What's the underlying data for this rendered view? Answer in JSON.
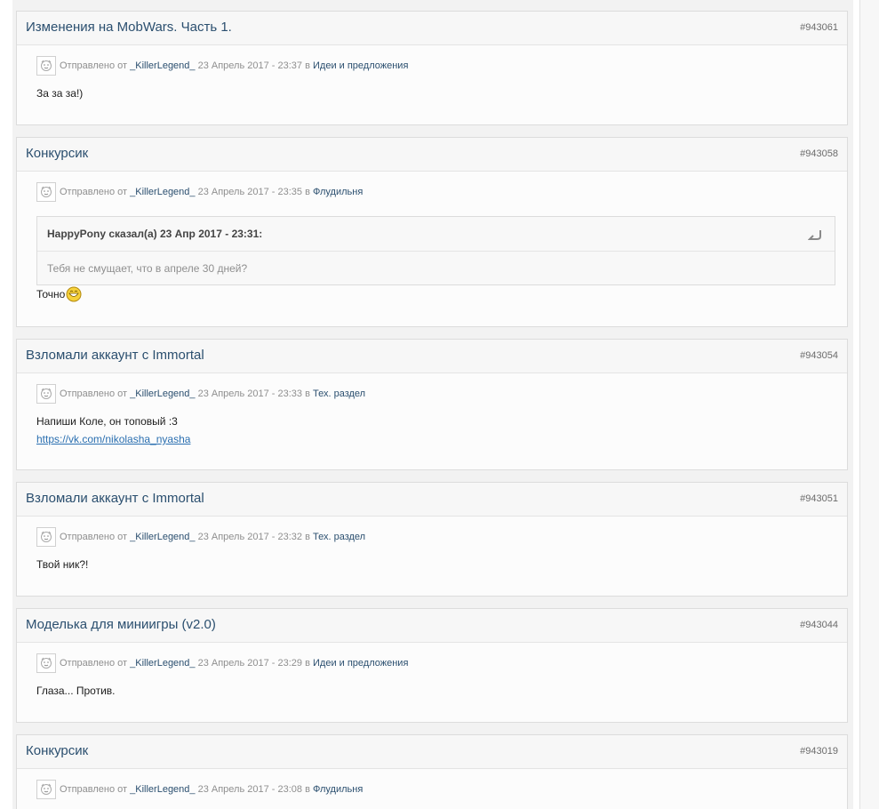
{
  "posts": [
    {
      "title": "Изменения на MobWars. Часть 1.",
      "number": "#943061",
      "meta_prefix": "Отправлено от",
      "author": "_KillerLegend_",
      "date": "23 Апрель 2017 - 23:37",
      "in_word": "в",
      "forum": "Идеи и предложения",
      "text": "За за за!)"
    },
    {
      "title": "Конкурсик",
      "number": "#943058",
      "meta_prefix": "Отправлено от",
      "author": "_KillerLegend_",
      "date": "23 Апрель 2017 - 23:35",
      "in_word": "в",
      "forum": "Флудильня",
      "quote_author": "HappyPony сказал(а) 23 Апр 2017 - 23:31:",
      "quote_text": "Тебя не смущает, что в апреле 30 дней?",
      "text": "Точно"
    },
    {
      "title": "Взломали аккаунт с Immortal",
      "number": "#943054",
      "meta_prefix": "Отправлено от",
      "author": "_KillerLegend_",
      "date": "23 Апрель 2017 - 23:33",
      "in_word": "в",
      "forum": "Тех. раздел",
      "text": "Напиши Коле, он топовый :3",
      "link": "https://vk.com/nikolasha_nyasha"
    },
    {
      "title": "Взломали аккаунт с Immortal",
      "number": "#943051",
      "meta_prefix": "Отправлено от",
      "author": "_KillerLegend_",
      "date": "23 Апрель 2017 - 23:32",
      "in_word": "в",
      "forum": "Тех. раздел",
      "text": "Твой ник?!"
    },
    {
      "title": "Моделька для миниигры (v2.0)",
      "number": "#943044",
      "meta_prefix": "Отправлено от",
      "author": "_KillerLegend_",
      "date": "23 Апрель 2017 - 23:29",
      "in_word": "в",
      "forum": "Идеи и предложения",
      "text": "Глаза... Против."
    },
    {
      "title": "Конкурсик",
      "number": "#943019",
      "meta_prefix": "Отправлено от",
      "author": "_KillerLegend_",
      "date": "23 Апрель 2017 - 23:08",
      "in_word": "в",
      "forum": "Флудильня"
    }
  ],
  "icons": {
    "avatar": "avatar-icon",
    "quote": "quote-arrow-icon",
    "smiley": "laughing-smiley-icon"
  },
  "colors": {
    "title": "#2b4f6f",
    "link": "#2a6fb0",
    "meta": "#8f8f8f"
  }
}
